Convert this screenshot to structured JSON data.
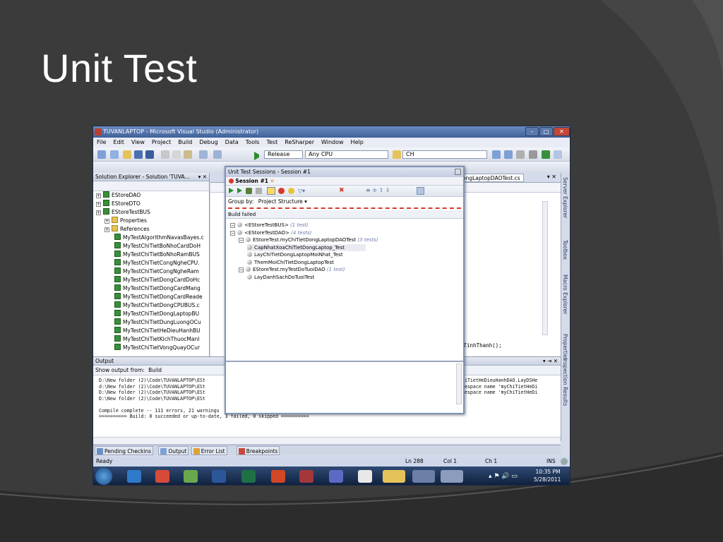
{
  "slide": {
    "title": "Unit Test"
  },
  "window": {
    "title": "TUVANLAPTOP - Microsoft Visual Studio (Administrator)"
  },
  "menu": [
    "File",
    "Edit",
    "View",
    "Project",
    "Build",
    "Debug",
    "Data",
    "Tools",
    "Test",
    "ReSharper",
    "Window",
    "Help"
  ],
  "toolbar": {
    "config": "Release",
    "platform": "Any CPU",
    "find": "CH"
  },
  "solution_explorer": {
    "title": "Solution Explorer - Solution 'TUVA...",
    "projects": [
      "EStoreDAO",
      "EStoreDTO",
      "EStoreTestBUS"
    ],
    "folders": [
      "Properties",
      "References"
    ],
    "files": [
      "MyTestAlgorithmNavasBayes.c",
      "MyTestChiTietBoNhoCardDoH",
      "MyTestChiTietBoNhoRamBUS",
      "MyTestChiTietCongNgheCPU.",
      "MyTestChiTietCongNgheRam",
      "MyTestChiTietDongCardDoHc",
      "MyTestChiTietDongCardMang",
      "MyTestChiTietDongCardReade",
      "MyTestChiTietDongCPUBUS.c",
      "MyTestChiTietDongLaptopBU",
      "MyTestChiTietDungLuongOCu",
      "MyTestChiTietHeDieuHanhBU",
      "MyTestChiTietKichThuocManl",
      "MyTestChiTietVongQuayOCur"
    ]
  },
  "editor": {
    "tab_label": "ongLaptopDAOTest.cs",
    "code_snippet": "yTinhThanh();"
  },
  "session": {
    "window_title": "Unit Test Sessions - Session #1",
    "tab_label": "Session #1",
    "group_by_label": "Group by:",
    "group_by_value": "Project Structure",
    "status": "Build failed",
    "nodes": [
      {
        "label": "<EStoreTestBUS>",
        "note": "(1 test)",
        "level": 0
      },
      {
        "label": "<EStoreTestDAO>",
        "note": "(4 tests)",
        "level": 0
      },
      {
        "label": "EStoreTest.myChiTietDongLaptopDAOTest",
        "note": "(3 tests)",
        "level": 1
      },
      {
        "label": "CapNhatXoaChiTietDongLaptop_Test",
        "note": "",
        "level": 2
      },
      {
        "label": "LayChiTietDongLaptopMoiNhat_Test",
        "note": "",
        "level": 2
      },
      {
        "label": "ThemMoiChiTietDongLaptopTest",
        "note": "",
        "level": 2
      },
      {
        "label": "EStoreTest.myTestDoTuoiDAO",
        "note": "(1 test)",
        "level": 1
      },
      {
        "label": "LayDanhSachDoTuoiTest",
        "note": "",
        "level": 2
      }
    ]
  },
  "output": {
    "title": "Output",
    "show_from_label": "Show output from:",
    "show_from_value": "Build",
    "lines": [
      "D:\\New folder (2)\\Code\\TUVANLAPTOP\\ESt",
      "d:\\New folder (2)\\Code\\TUVANLAPTOP\\ESt",
      "D:\\New folder (2)\\Code\\TUVANLAPTOP\\ESt",
      "D:\\New folder (2)\\Code\\TUVANLAPTOP\\ESt",
      "",
      "Compile complete -- 111 errors, 21 warnings",
      "========== Build: 0 succeeded or up-to-date, 3 failed, 0 skipped =========="
    ],
    "right_lines": [
      "hiTietHeDieuHanhDAO.LayDSHe",
      "mespace name 'myChiTietHeDi",
      "mespace name 'myChiTietHeDi"
    ]
  },
  "bottom_tabs": [
    "Pending Checkins",
    "Output",
    "Error List",
    "Breakpoints"
  ],
  "statusbar": {
    "left": "Ready",
    "ln": "Ln 288",
    "col": "Col 1",
    "ch": "Ch 1",
    "mode": "INS"
  },
  "right_rail": [
    "Server Explorer",
    "Toolbox",
    "Macro Explorer",
    "Properties",
    "Inspection Results"
  ],
  "taskbar": {
    "time": "10:35 PM",
    "date": "5/28/2011"
  }
}
